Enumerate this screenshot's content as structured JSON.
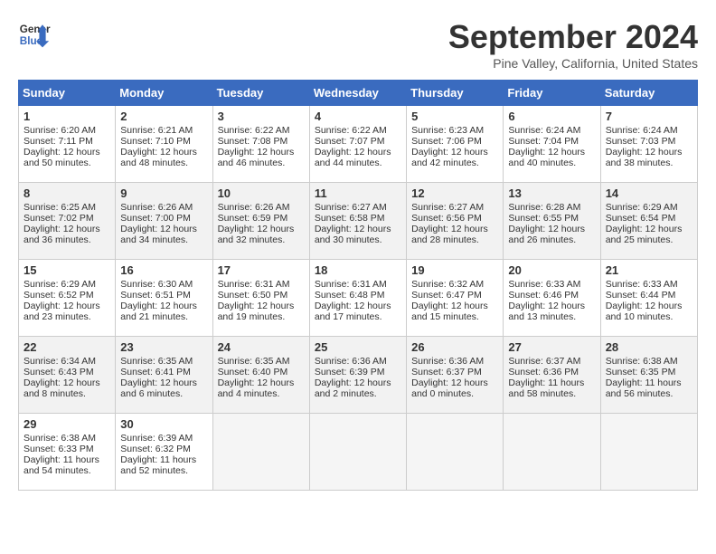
{
  "header": {
    "logo_line1": "General",
    "logo_line2": "Blue",
    "month": "September 2024",
    "location": "Pine Valley, California, United States"
  },
  "days_of_week": [
    "Sunday",
    "Monday",
    "Tuesday",
    "Wednesday",
    "Thursday",
    "Friday",
    "Saturday"
  ],
  "weeks": [
    [
      {
        "day": "1",
        "sunrise": "6:20 AM",
        "sunset": "7:11 PM",
        "daylight": "12 hours and 50 minutes."
      },
      {
        "day": "2",
        "sunrise": "6:21 AM",
        "sunset": "7:10 PM",
        "daylight": "12 hours and 48 minutes."
      },
      {
        "day": "3",
        "sunrise": "6:22 AM",
        "sunset": "7:08 PM",
        "daylight": "12 hours and 46 minutes."
      },
      {
        "day": "4",
        "sunrise": "6:22 AM",
        "sunset": "7:07 PM",
        "daylight": "12 hours and 44 minutes."
      },
      {
        "day": "5",
        "sunrise": "6:23 AM",
        "sunset": "7:06 PM",
        "daylight": "12 hours and 42 minutes."
      },
      {
        "day": "6",
        "sunrise": "6:24 AM",
        "sunset": "7:04 PM",
        "daylight": "12 hours and 40 minutes."
      },
      {
        "day": "7",
        "sunrise": "6:24 AM",
        "sunset": "7:03 PM",
        "daylight": "12 hours and 38 minutes."
      }
    ],
    [
      {
        "day": "8",
        "sunrise": "6:25 AM",
        "sunset": "7:02 PM",
        "daylight": "12 hours and 36 minutes."
      },
      {
        "day": "9",
        "sunrise": "6:26 AM",
        "sunset": "7:00 PM",
        "daylight": "12 hours and 34 minutes."
      },
      {
        "day": "10",
        "sunrise": "6:26 AM",
        "sunset": "6:59 PM",
        "daylight": "12 hours and 32 minutes."
      },
      {
        "day": "11",
        "sunrise": "6:27 AM",
        "sunset": "6:58 PM",
        "daylight": "12 hours and 30 minutes."
      },
      {
        "day": "12",
        "sunrise": "6:27 AM",
        "sunset": "6:56 PM",
        "daylight": "12 hours and 28 minutes."
      },
      {
        "day": "13",
        "sunrise": "6:28 AM",
        "sunset": "6:55 PM",
        "daylight": "12 hours and 26 minutes."
      },
      {
        "day": "14",
        "sunrise": "6:29 AM",
        "sunset": "6:54 PM",
        "daylight": "12 hours and 25 minutes."
      }
    ],
    [
      {
        "day": "15",
        "sunrise": "6:29 AM",
        "sunset": "6:52 PM",
        "daylight": "12 hours and 23 minutes."
      },
      {
        "day": "16",
        "sunrise": "6:30 AM",
        "sunset": "6:51 PM",
        "daylight": "12 hours and 21 minutes."
      },
      {
        "day": "17",
        "sunrise": "6:31 AM",
        "sunset": "6:50 PM",
        "daylight": "12 hours and 19 minutes."
      },
      {
        "day": "18",
        "sunrise": "6:31 AM",
        "sunset": "6:48 PM",
        "daylight": "12 hours and 17 minutes."
      },
      {
        "day": "19",
        "sunrise": "6:32 AM",
        "sunset": "6:47 PM",
        "daylight": "12 hours and 15 minutes."
      },
      {
        "day": "20",
        "sunrise": "6:33 AM",
        "sunset": "6:46 PM",
        "daylight": "12 hours and 13 minutes."
      },
      {
        "day": "21",
        "sunrise": "6:33 AM",
        "sunset": "6:44 PM",
        "daylight": "12 hours and 10 minutes."
      }
    ],
    [
      {
        "day": "22",
        "sunrise": "6:34 AM",
        "sunset": "6:43 PM",
        "daylight": "12 hours and 8 minutes."
      },
      {
        "day": "23",
        "sunrise": "6:35 AM",
        "sunset": "6:41 PM",
        "daylight": "12 hours and 6 minutes."
      },
      {
        "day": "24",
        "sunrise": "6:35 AM",
        "sunset": "6:40 PM",
        "daylight": "12 hours and 4 minutes."
      },
      {
        "day": "25",
        "sunrise": "6:36 AM",
        "sunset": "6:39 PM",
        "daylight": "12 hours and 2 minutes."
      },
      {
        "day": "26",
        "sunrise": "6:36 AM",
        "sunset": "6:37 PM",
        "daylight": "12 hours and 0 minutes."
      },
      {
        "day": "27",
        "sunrise": "6:37 AM",
        "sunset": "6:36 PM",
        "daylight": "11 hours and 58 minutes."
      },
      {
        "day": "28",
        "sunrise": "6:38 AM",
        "sunset": "6:35 PM",
        "daylight": "11 hours and 56 minutes."
      }
    ],
    [
      {
        "day": "29",
        "sunrise": "6:38 AM",
        "sunset": "6:33 PM",
        "daylight": "11 hours and 54 minutes."
      },
      {
        "day": "30",
        "sunrise": "6:39 AM",
        "sunset": "6:32 PM",
        "daylight": "11 hours and 52 minutes."
      },
      null,
      null,
      null,
      null,
      null
    ]
  ]
}
